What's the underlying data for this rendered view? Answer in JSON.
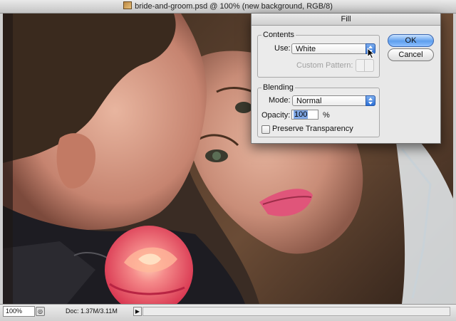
{
  "window": {
    "title": "bride-and-groom.psd @ 100% (new background, RGB/8)"
  },
  "statusbar": {
    "zoom": "100%",
    "doc_info": "Doc: 1.37M/3.11M",
    "arrow_icon": "triangle-right-icon"
  },
  "dialog": {
    "title": "Fill",
    "contents": {
      "group_label": "Contents",
      "use_label": "Use:",
      "use_value": "White",
      "custom_pattern_label": "Custom Pattern:"
    },
    "blending": {
      "group_label": "Blending",
      "mode_label": "Mode:",
      "mode_value": "Normal",
      "opacity_label": "Opacity:",
      "opacity_value": "100",
      "opacity_unit": "%",
      "preserve_label": "Preserve Transparency",
      "preserve_checked": false
    },
    "buttons": {
      "ok": "OK",
      "cancel": "Cancel"
    }
  }
}
